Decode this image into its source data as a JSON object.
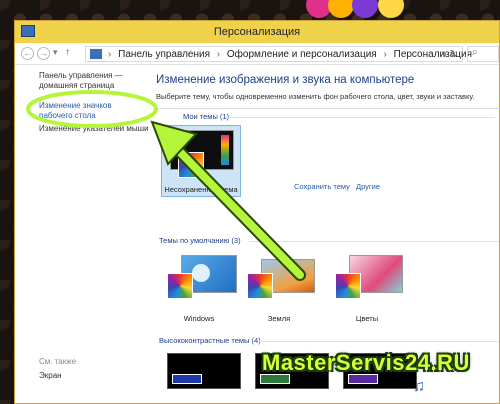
{
  "window": {
    "title": "Персонализация"
  },
  "address": {
    "crumbs": [
      "Панель управления",
      "Оформление и персонализация",
      "Персонализация"
    ],
    "separator": "›",
    "dropdown": "v",
    "refresh": "↻",
    "search_icon": "search-icon"
  },
  "left_pane": {
    "home": "Панель управления — домашняя страница",
    "change_icons": "Изменение значков рабочего стола",
    "change_pointer": "Изменение указателей мыши",
    "see_also": "См. также",
    "screen": "Экран"
  },
  "main": {
    "title": "Изменение изображения и звука на компьютере",
    "subtitle": "Выберите тему, чтобы одновременно изменить фон рабочего стола, цвет, звуки и заставку."
  },
  "sections": {
    "my_themes": "Мои темы (1)",
    "default_themes": "Темы по умолчанию (3)",
    "high_contrast": "Высококонтрастные темы (4)"
  },
  "my_themes": [
    {
      "label": "Несохраненная тема"
    }
  ],
  "default_themes": [
    {
      "label": "Windows"
    },
    {
      "label": "Земля"
    },
    {
      "label": "Цветы"
    }
  ],
  "links": {
    "save_theme": "Сохранить тему",
    "other": "Другие"
  },
  "watermark": "MasterServis24.RU",
  "colors": {
    "titlebar": "#f0d24a",
    "accent_arrow": "#b5f53a",
    "link": "#1f5fad"
  }
}
